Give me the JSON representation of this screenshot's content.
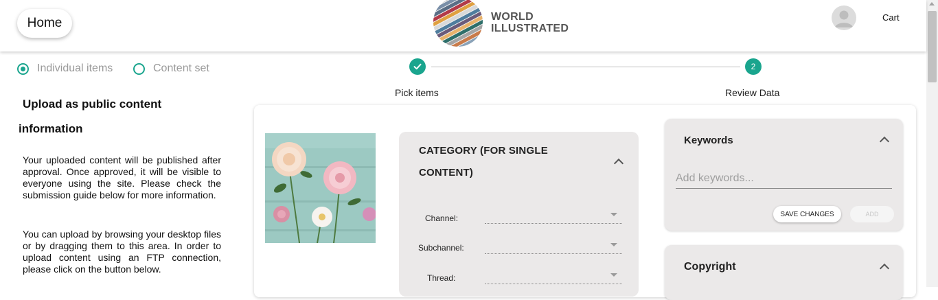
{
  "header": {
    "home_label": "Home",
    "logo_line1": "WORLD",
    "logo_line2": "ILLUSTRATED",
    "cart_label": "Cart"
  },
  "upload_mode": {
    "options": [
      {
        "label": "Individual items",
        "selected": true
      },
      {
        "label": "Content set",
        "selected": false
      }
    ]
  },
  "info": {
    "title_line1": "Upload as public content",
    "title_line2": "information",
    "paragraph1": "Your uploaded content will be published after approval. Once approved, it will be visible to everyone using the site. Please check the submission guide below for more information.",
    "paragraph2": "You can upload by browsing your desktop files or by dragging them to this area. In order to upload content using an FTP connection, please click on the button below."
  },
  "stepper": {
    "steps": [
      {
        "label": "Pick items",
        "state": "done"
      },
      {
        "label": "Review Data",
        "number": "2",
        "state": "active"
      }
    ]
  },
  "category": {
    "title_line1": "CATEGORY (FOR SINGLE",
    "title_line2": "CONTENT)",
    "fields": [
      {
        "label": "Channel:",
        "value": ""
      },
      {
        "label": "Subchannel:",
        "value": ""
      },
      {
        "label": "Thread:",
        "value": ""
      }
    ]
  },
  "keywords": {
    "title": "Keywords",
    "placeholder": "Add keywords...",
    "save_label": "SAVE CHANGES",
    "add_label": "ADD"
  },
  "copyright": {
    "title": "Copyright"
  },
  "colors": {
    "accent": "#1aa58e",
    "panel_bg": "#ebe9e9"
  }
}
